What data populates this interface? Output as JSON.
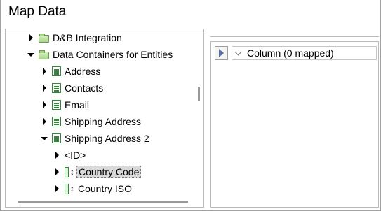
{
  "title": "Map Data",
  "tree": {
    "items": [
      {
        "label": "D&B Integration",
        "expanded": false,
        "icon": "folder-icon"
      },
      {
        "label": "Data Containers for Entities",
        "expanded": true,
        "icon": "folder-icon"
      },
      {
        "label": "Address",
        "expanded": false,
        "icon": "entity-icon"
      },
      {
        "label": "Contacts",
        "expanded": false,
        "icon": "entity-icon"
      },
      {
        "label": "Email",
        "expanded": false,
        "icon": "entity-icon"
      },
      {
        "label": "Shipping Address",
        "expanded": false,
        "icon": "entity-icon"
      },
      {
        "label": "Shipping Address 2",
        "expanded": true,
        "icon": "entity-icon"
      },
      {
        "label": "<ID>",
        "expanded": false,
        "icon": ""
      },
      {
        "label": "Country Code",
        "expanded": false,
        "icon": "field-icon",
        "selected": true
      },
      {
        "label": "Country ISO",
        "expanded": false,
        "icon": "field-icon"
      }
    ]
  },
  "mapping": {
    "column_header": "Column (0 mapped)",
    "play_icon": "play-icon"
  }
}
